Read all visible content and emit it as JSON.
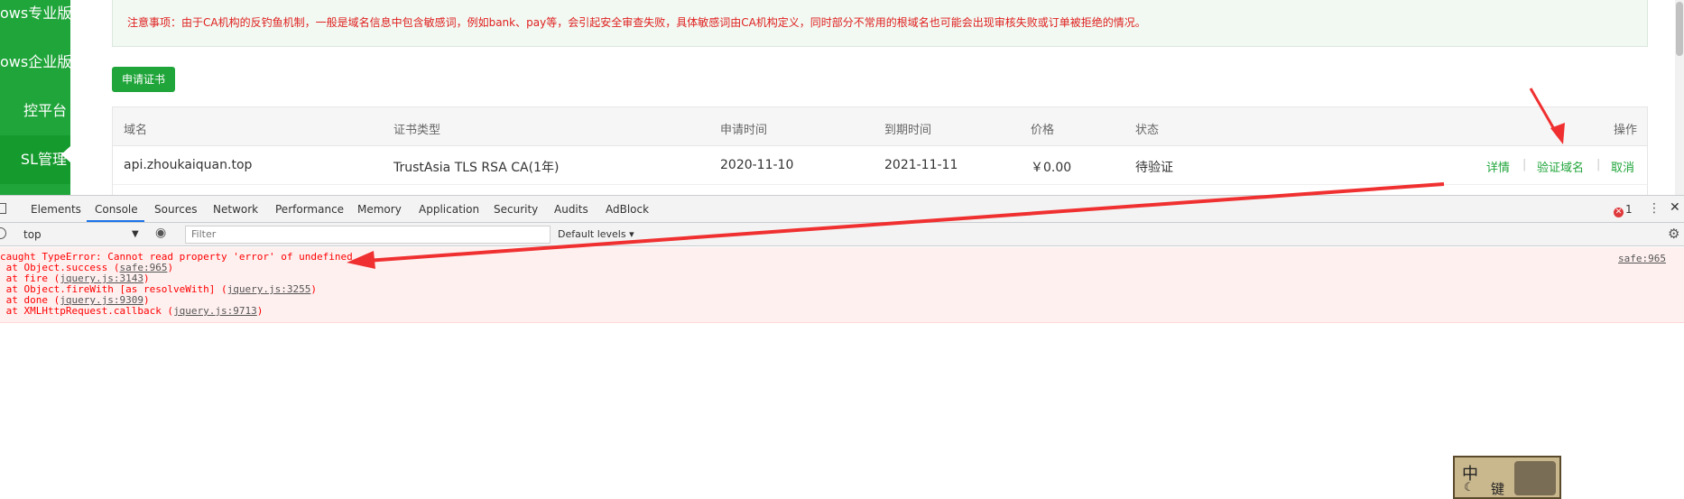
{
  "sidebar": {
    "items": [
      {
        "label": "ows专业版"
      },
      {
        "label": "ows企业版"
      },
      {
        "label": "控平台"
      },
      {
        "label": "SL管理"
      }
    ]
  },
  "notice": {
    "text": "注意事项：由于CA机构的反钓鱼机制，一般是域名信息中包含敏感词，例如bank、pay等，会引起安全审查失败，具体敏感词由CA机构定义，同时部分不常用的根域名也可能会出现审核失败或订单被拒绝的情况。"
  },
  "apply_button": "申请证书",
  "table": {
    "headers": [
      "域名",
      "证书类型",
      "申请时间",
      "到期时间",
      "价格",
      "状态",
      "操作"
    ],
    "row": {
      "domain": "api.zhoukaiquan.top",
      "cert_type": "TrustAsia TLS RSA CA(1年)",
      "apply_time": "2020-11-10",
      "expire_time": "2021-11-11",
      "price": "￥0.00",
      "status": "待验证",
      "actions": [
        "详情",
        "验证域名",
        "取消"
      ],
      "separator": "|"
    }
  },
  "devtools": {
    "tabs": [
      "Elements",
      "Console",
      "Sources",
      "Network",
      "Performance",
      "Memory",
      "Application",
      "Security",
      "Audits",
      "AdBlock"
    ],
    "active_tab": "Console",
    "error_count": "1",
    "context": "top",
    "filter_placeholder": "Filter",
    "levels": "Default levels ▾",
    "error": {
      "message": "caught TypeError: Cannot read property 'error' of undefined",
      "source": "safe:965",
      "stack": [
        {
          "prefix": "at Object.success (",
          "link": "safe:965",
          "suffix": ")"
        },
        {
          "prefix": "at fire (",
          "link": "jquery.js:3143",
          "suffix": ")"
        },
        {
          "prefix": "at Object.fireWith [as resolveWith] (",
          "link": "jquery.js:3255",
          "suffix": ")"
        },
        {
          "prefix": "at done (",
          "link": "jquery.js:9309",
          "suffix": ")"
        },
        {
          "prefix": "at XMLHttpRequest.callback (",
          "link": "jquery.js:9713",
          "suffix": ")"
        }
      ]
    }
  },
  "ime": {
    "zh": "中",
    "key": "键"
  },
  "colors": {
    "brand_green": "#20a53a",
    "error_red": "#ff0000",
    "annotation_arrow": "#f03030"
  }
}
